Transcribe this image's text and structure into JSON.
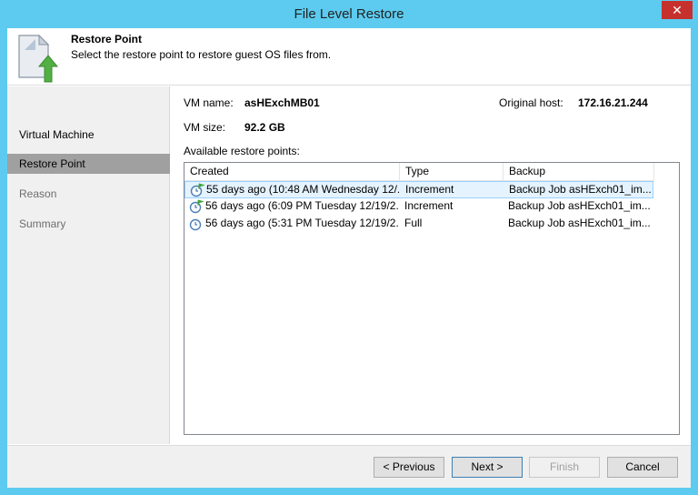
{
  "window": {
    "title": "File Level Restore",
    "close_glyph": "✕"
  },
  "header": {
    "title": "Restore Point",
    "subtitle": "Select the restore point to restore guest OS files from.",
    "icon": "restore-document-icon"
  },
  "sidebar": {
    "items": [
      {
        "label": "Virtual Machine",
        "state": "normal"
      },
      {
        "label": "Restore Point",
        "state": "active"
      },
      {
        "label": "Reason",
        "state": "disabled"
      },
      {
        "label": "Summary",
        "state": "disabled"
      }
    ]
  },
  "vm": {
    "name_label": "VM name:",
    "name_value": "asHExchMB01",
    "size_label": "VM size:",
    "size_value": "92.2 GB",
    "host_label": "Original host:",
    "host_value": "172.16.21.244"
  },
  "restore_points": {
    "label": "Available restore points:",
    "columns": [
      "Created",
      "Type",
      "Backup"
    ],
    "rows": [
      {
        "created": "55 days ago (10:48 AM Wednesday 12/...",
        "type": "Increment",
        "backup": "Backup Job asHExch01_im...",
        "selected": true
      },
      {
        "created": "56 days ago (6:09 PM Tuesday 12/19/2...",
        "type": "Increment",
        "backup": "Backup Job asHExch01_im...",
        "selected": false
      },
      {
        "created": "56 days ago (5:31 PM Tuesday 12/19/2...",
        "type": "Full",
        "backup": "Backup Job asHExch01_im...",
        "selected": false
      }
    ]
  },
  "footer": {
    "previous": "< Previous",
    "next": "Next >",
    "finish": "Finish",
    "cancel": "Cancel"
  },
  "colors": {
    "titlebar": "#5ccbef",
    "selection": "#e5f3ff",
    "active_nav": "#a0a0a0",
    "close": "#c7312d"
  }
}
